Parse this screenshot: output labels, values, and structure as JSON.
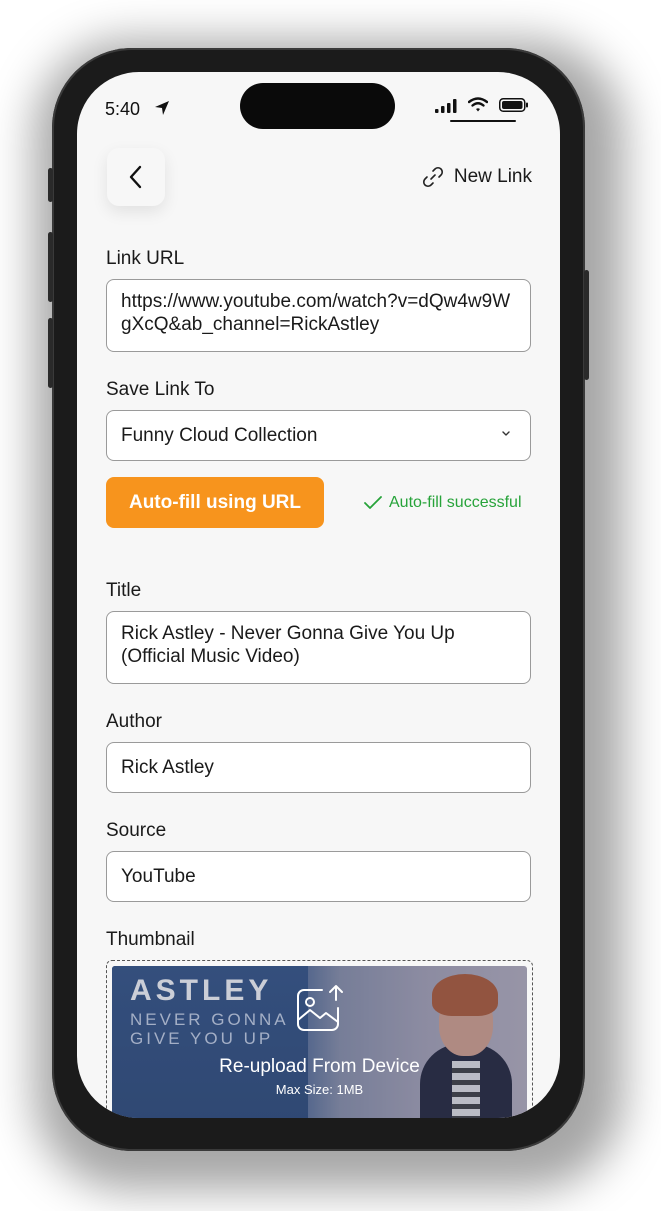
{
  "status_bar": {
    "time": "5:40"
  },
  "header": {
    "new_link_label": "New Link"
  },
  "link_url": {
    "label": "Link URL",
    "value": "https://www.youtube.com/watch?v=dQw4w9WgXcQ&ab_channel=RickAstley"
  },
  "save_link_to": {
    "label": "Save Link To",
    "selected": "Funny Cloud Collection"
  },
  "autofill": {
    "button_label": "Auto-fill using URL",
    "status": "Auto-fill successful"
  },
  "title": {
    "label": "Title",
    "value": "Rick Astley - Never Gonna Give You Up (Official Music Video)"
  },
  "author": {
    "label": "Author",
    "value": "Rick Astley"
  },
  "source": {
    "label": "Source",
    "value": "YouTube"
  },
  "thumbnail": {
    "label": "Thumbnail",
    "image_text_1": "ASTLEY",
    "image_text_2": "NEVER GONNA\nGIVE YOU UP",
    "reupload_label": "Re-upload From Device",
    "max_size": "Max Size: 1MB"
  },
  "colors": {
    "accent": "#f7941d",
    "success": "#27a33a"
  }
}
